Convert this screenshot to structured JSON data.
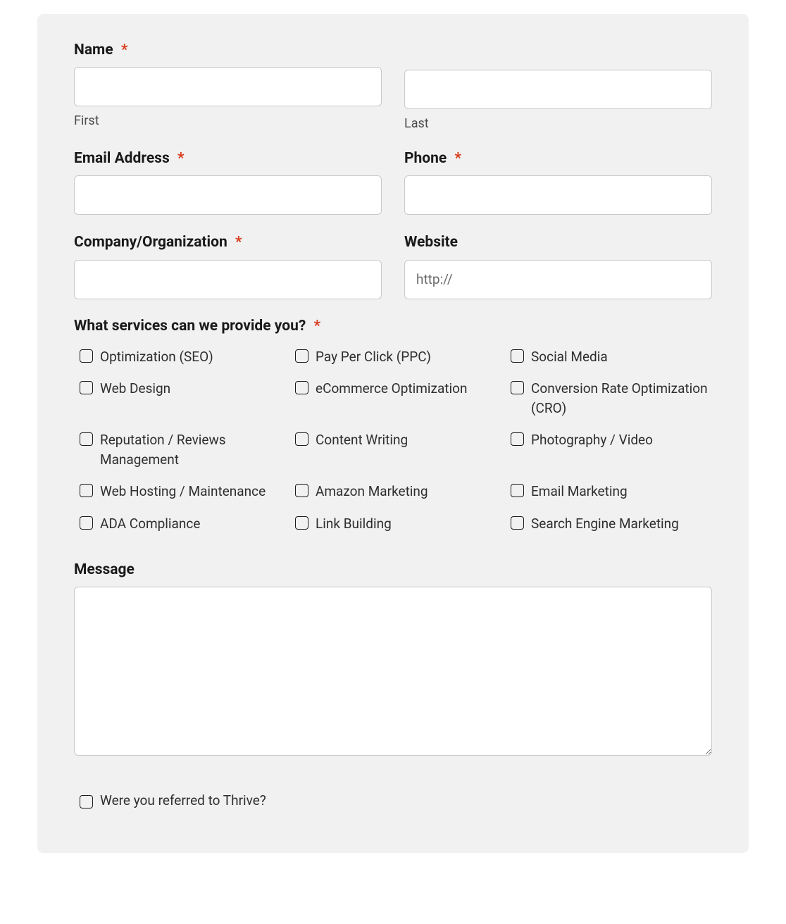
{
  "name": {
    "label": "Name",
    "first_sublabel": "First",
    "last_sublabel": "Last",
    "first_value": "",
    "last_value": ""
  },
  "email": {
    "label": "Email Address",
    "value": ""
  },
  "phone": {
    "label": "Phone",
    "value": ""
  },
  "company": {
    "label": "Company/Organization",
    "value": ""
  },
  "website": {
    "label": "Website",
    "placeholder": "http://",
    "value": ""
  },
  "services": {
    "label": "What services can we provide you?",
    "options": [
      "Optimization (SEO)",
      "Pay Per Click (PPC)",
      "Social Media",
      "Web Design",
      "eCommerce Optimization",
      "Conversion Rate Optimization (CRO)",
      "Reputation / Reviews Management",
      "Content Writing",
      "Photography / Video",
      "Web Hosting / Maintenance",
      "Amazon Marketing",
      "Email Marketing",
      "ADA Compliance",
      "Link Building",
      "Search Engine Marketing"
    ]
  },
  "message": {
    "label": "Message",
    "value": ""
  },
  "referral": {
    "label": "Were you referred to Thrive?"
  },
  "required_marker": "*"
}
